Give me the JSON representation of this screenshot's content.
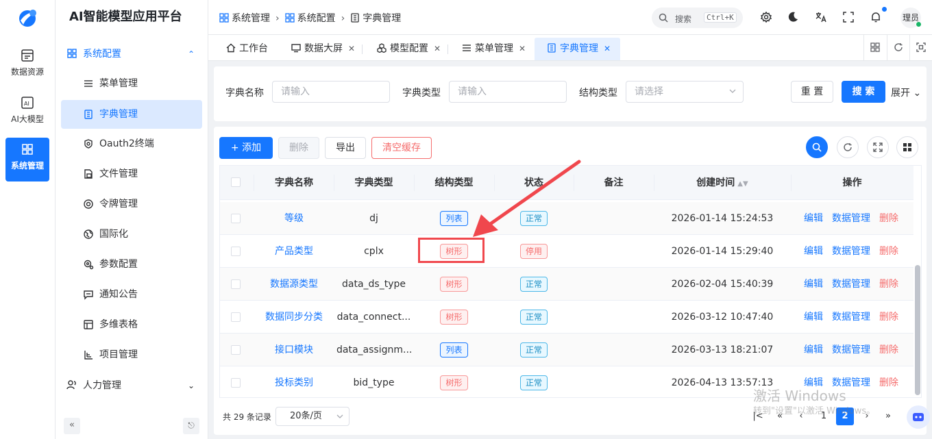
{
  "app": {
    "title": "AI智能模型应用平台"
  },
  "rail": [
    {
      "label": "数据资源",
      "icon": "database-icon"
    },
    {
      "label": "AI大模型",
      "icon": "ai-icon"
    },
    {
      "label": "系统管理",
      "icon": "system-icon",
      "active": true
    }
  ],
  "menu": {
    "group_system": "系统配置",
    "items": [
      "菜单管理",
      "字典管理",
      "Oauth2终端",
      "文件管理",
      "令牌管理",
      "国际化",
      "参数配置",
      "通知公告",
      "多维表格",
      "项目管理"
    ],
    "group_hr": "人力管理"
  },
  "breadcrumb": [
    "系统管理",
    "系统配置",
    "字典管理"
  ],
  "header": {
    "search_label": "搜索",
    "search_shortcut": "Ctrl+K",
    "user": "理员"
  },
  "tabs": [
    "工作台",
    "数据大屏",
    "模型配置",
    "菜单管理",
    "字典管理"
  ],
  "filters": {
    "name_label": "字典名称",
    "name_placeholder": "请输入",
    "type_label": "字典类型",
    "type_placeholder": "请输入",
    "struct_label": "结构类型",
    "struct_placeholder": "请选择",
    "reset": "重 置",
    "search": "搜 索",
    "expand": "展开"
  },
  "toolbar": {
    "add": "添加",
    "delete": "删除",
    "export": "导出",
    "clear_cache": "清空缓存"
  },
  "table": {
    "columns": [
      "字典名称",
      "字典类型",
      "结构类型",
      "状态",
      "备注",
      "创建时间",
      "操作"
    ],
    "rows": [
      {
        "name": "等级",
        "type": "dj",
        "struct": "列表",
        "status": "正常",
        "remark": "",
        "created": "2026-01-14 15:24:53"
      },
      {
        "name": "产品类型",
        "type": "cplx",
        "struct": "树形",
        "status": "停用",
        "remark": "",
        "created": "2026-01-14 15:29:40"
      },
      {
        "name": "数据源类型",
        "type": "data_ds_type",
        "struct": "树形",
        "status": "正常",
        "remark": "",
        "created": "2026-02-04 15:40:39"
      },
      {
        "name": "数据同步分类",
        "type": "data_connect...",
        "struct": "树形",
        "status": "正常",
        "remark": "",
        "created": "2026-03-12 10:47:40"
      },
      {
        "name": "接口模块",
        "type": "data_assignm...",
        "struct": "列表",
        "status": "正常",
        "remark": "",
        "created": "2026-03-13 18:21:07"
      },
      {
        "name": "投标类别",
        "type": "bid_type",
        "struct": "树形",
        "status": "正常",
        "remark": "",
        "created": "2026-04-13 13:57:13"
      }
    ],
    "ops": {
      "edit": "编辑",
      "data": "数据管理",
      "delete": "删除"
    }
  },
  "pager": {
    "total": "共 29 条记录",
    "size": "20条/页",
    "pages": [
      "1",
      "2"
    ],
    "current": "2"
  },
  "watermark": {
    "line1": "激活 Windows",
    "line2": "转到\"设置\"以激活 Windows。"
  },
  "colors": {
    "primary": "#1677ff",
    "danger": "#f56c6c",
    "annotation": "#f0474d"
  }
}
